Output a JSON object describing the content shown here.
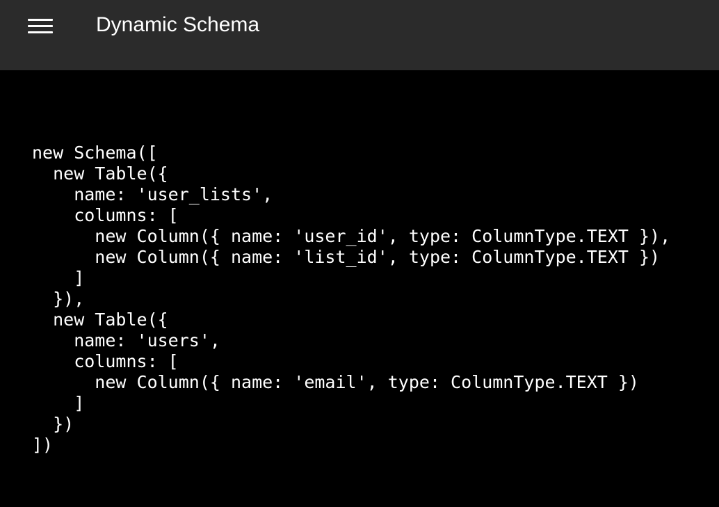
{
  "header": {
    "title": "Dynamic Schema",
    "menu_icon": "hamburger-menu-icon"
  },
  "code": {
    "lines": [
      "new Schema([",
      "  new Table({",
      "    name: 'user_lists',",
      "    columns: [",
      "      new Column({ name: 'user_id', type: ColumnType.TEXT }),",
      "      new Column({ name: 'list_id', type: ColumnType.TEXT })",
      "    ]",
      "  }),",
      "  new Table({",
      "    name: 'users',",
      "    columns: [",
      "      new Column({ name: 'email', type: ColumnType.TEXT })",
      "    ]",
      "  })",
      "])"
    ]
  },
  "colors": {
    "app_bar": "#2b2b2b",
    "background": "#000000",
    "text": "#ffffff"
  }
}
